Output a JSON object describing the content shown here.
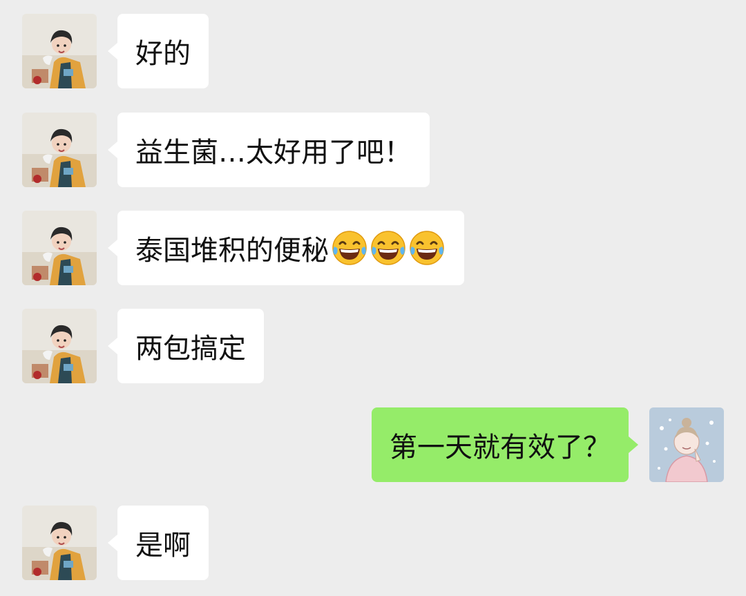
{
  "messages": [
    {
      "side": "in",
      "text": "好的"
    },
    {
      "side": "in",
      "text": "益生菌…太好用了吧！"
    },
    {
      "side": "in",
      "text": "泰国堆积的便秘",
      "emoji": [
        "laughing-tears-emoji",
        "laughing-tears-emoji",
        "laughing-tears-emoji"
      ]
    },
    {
      "side": "in",
      "text": "两包搞定"
    },
    {
      "side": "out",
      "text": "第一天就有效了？"
    },
    {
      "side": "in",
      "text": "是啊"
    }
  ],
  "colors": {
    "background": "#ededed",
    "incoming_bubble": "#ffffff",
    "outgoing_bubble": "#95ec69"
  },
  "icons": {
    "contact_avatar": "photo-avatar-icon",
    "self_avatar": "cartoon-avatar-icon",
    "emoji": "laughing-tears-emoji"
  }
}
